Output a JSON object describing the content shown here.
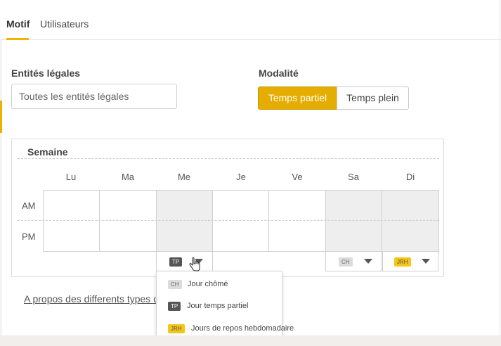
{
  "tabs": [
    {
      "label": "Motif",
      "active": true
    },
    {
      "label": "Utilisateurs",
      "active": false
    }
  ],
  "entities": {
    "label": "Entités légales",
    "placeholder": "Toutes les entités légales"
  },
  "modality": {
    "label": "Modalité",
    "options": [
      "Temps partiel",
      "Temps plein"
    ],
    "selected": "Temps partiel"
  },
  "week": {
    "title": "Semaine",
    "days": [
      "Lu",
      "Ma",
      "Me",
      "Je",
      "Ve",
      "Sa",
      "Di"
    ],
    "periods": [
      "AM",
      "PM"
    ],
    "day_selectors": [
      {
        "day": "Me",
        "tag": "TP"
      },
      {
        "day": "Sa",
        "tag": "CH"
      },
      {
        "day": "Di",
        "tag": "JRH"
      }
    ]
  },
  "dropdown_menu": {
    "items": [
      {
        "tag": "CH",
        "label": "Jour chômé"
      },
      {
        "tag": "TP",
        "label": "Jour temps partiel"
      },
      {
        "tag": "JRH",
        "label": "Jours de repos hebdomadaire"
      }
    ]
  },
  "about_link": "A propos des differents types de jours",
  "colors": {
    "accent": "#e5ad00",
    "tag_tp": "#555555",
    "tag_ch": "#dcdcdc",
    "tag_jrh": "#f5c518"
  },
  "icons": [
    "caret-down-icon",
    "hand-pointer-icon"
  ]
}
